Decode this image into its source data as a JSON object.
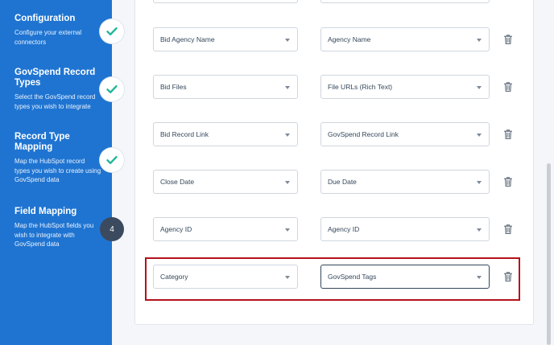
{
  "sidebar": {
    "steps": [
      {
        "title": "Configuration",
        "description": "Configure your external connectors",
        "status": "complete"
      },
      {
        "title": "GovSpend Record Types",
        "description": "Select the GovSpend record types you wish to integrate",
        "status": "complete"
      },
      {
        "title": "Record Type Mapping",
        "description": "Map the HubSpot record types you wish to create using GovSpend data",
        "status": "complete"
      },
      {
        "title": "Field Mapping",
        "description": "Map the HubSpot fields you wish to integrate with GovSpend data",
        "status": "current",
        "number": "4"
      }
    ]
  },
  "mappings": [
    {
      "hubspot_field": "Bid Agency Name",
      "govspend_field": "Agency Name"
    },
    {
      "hubspot_field": "Bid Files",
      "govspend_field": "File URLs (Rich Text)"
    },
    {
      "hubspot_field": "Bid Record Link",
      "govspend_field": "GovSpend Record Link"
    },
    {
      "hubspot_field": "Close Date",
      "govspend_field": "Due Date"
    },
    {
      "hubspot_field": "Agency ID",
      "govspend_field": "Agency ID"
    },
    {
      "hubspot_field": "Category",
      "govspend_field": "GovSpend Tags"
    }
  ],
  "colors": {
    "sidebar": "#1f74d1",
    "check": "#1fb598",
    "highlight": "#b3111a"
  }
}
